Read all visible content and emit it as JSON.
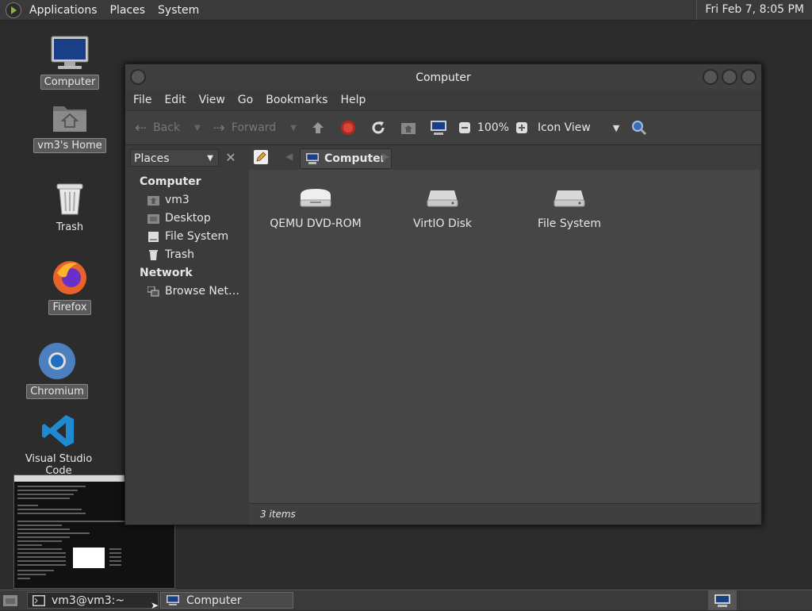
{
  "top_panel": {
    "menus": [
      "Applications",
      "Places",
      "System"
    ],
    "clock": "Fri Feb  7,  8:05 PM"
  },
  "desktop": {
    "icons": [
      {
        "label": "Computer",
        "icon": "computer-icon"
      },
      {
        "label": "vm3's Home",
        "icon": "home-folder-icon"
      },
      {
        "label": "Trash",
        "icon": "trash-icon"
      },
      {
        "label": "Firefox",
        "icon": "firefox-icon"
      },
      {
        "label": "Chromium",
        "icon": "chromium-icon"
      },
      {
        "label": "Visual Studio Code",
        "icon": "vscode-icon"
      }
    ]
  },
  "window": {
    "title": "Computer",
    "menu": [
      "File",
      "Edit",
      "View",
      "Go",
      "Bookmarks",
      "Help"
    ],
    "toolbar": {
      "back": "Back",
      "forward": "Forward",
      "zoom": "100%",
      "view_mode": "Icon View"
    },
    "sidebar": {
      "selector": "Places",
      "sections": [
        {
          "header": "Computer",
          "items": [
            "vm3",
            "Desktop",
            "File System",
            "Trash"
          ]
        },
        {
          "header": "Network",
          "items": [
            "Browse Net…"
          ]
        }
      ]
    },
    "pathbar": {
      "current": "Computer"
    },
    "items": [
      {
        "label": "QEMU DVD-ROM",
        "icon": "optical-drive-icon"
      },
      {
        "label": "VirtIO Disk",
        "icon": "hard-disk-icon"
      },
      {
        "label": "File System",
        "icon": "hard-disk-icon"
      }
    ],
    "status": "3 items"
  },
  "taskbar": {
    "tasks": [
      "vm3@vm3:~",
      "Computer"
    ]
  },
  "colors": {
    "accent_red": "#c0392b",
    "vscode_blue": "#1f8ad2",
    "firefox_orange": "#e8632b"
  }
}
